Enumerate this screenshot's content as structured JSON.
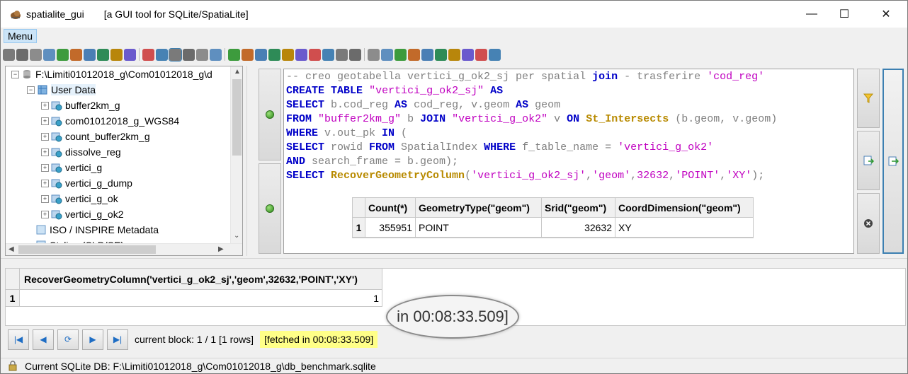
{
  "window": {
    "app_name": "spatialite_gui",
    "description": "[a GUI tool for SQLite/SpatiaLite]",
    "minimize_glyph": "—",
    "maximize_glyph": "☐",
    "close_glyph": "✕"
  },
  "menu": {
    "label": "Menu"
  },
  "toolbar": {
    "icons": [
      "connect-icon",
      "disconnect-icon",
      "create-db-icon",
      "memory-db-icon",
      "vacuum-icon",
      "attach-icon",
      "sql-script-icon",
      "load-shp-icon",
      "virtual-shp-icon",
      "load-dbf-icon",
      "load-xl-icon",
      "virtual-table-icon",
      "query-builder-icon",
      "srid-icon",
      "bug-icon",
      "eraser-icon",
      "export-icon",
      "import-icon",
      "map-icon",
      "globe-icon",
      "check-icon",
      "table-icon",
      "grid-icon",
      "report-icon",
      "calc-icon",
      "layers-icon",
      "eye-icon",
      "list-icon",
      "stats-icon",
      "wifi-icon",
      "charset-icon",
      "tools-icon",
      "text-icon",
      "help-icon",
      "about-icon",
      "exit-icon"
    ]
  },
  "tree": {
    "root": "F:\\Limiti01012018_g\\Com01012018_g\\d",
    "user_data": "User Data",
    "tables": [
      "buffer2km_g",
      "com01012018_g_WGS84",
      "count_buffer2km_g",
      "dissolve_reg",
      "vertici_g",
      "vertici_g_dump",
      "vertici_g_ok",
      "vertici_g_ok2"
    ],
    "metadata": "ISO / INSPIRE Metadata",
    "styling": "Styling (SLD/SE)"
  },
  "sql": {
    "line1_comment": "-- creo geotabella vertici_g_ok2_sj per spatial ",
    "line1_kw": "join",
    "line1_rest": " - trasferire ",
    "line1_str": "'cod_reg'",
    "create": "CREATE",
    "table": "TABLE",
    "table_name": "\"vertici_g_ok2_sj\"",
    "as": "AS",
    "select": "SELECT",
    "line3_a": " b.cod_reg ",
    "line3_b": " cod_reg, v.geom ",
    "line3_c": " geom",
    "from": "FROM",
    "buffer_tbl": "\"buffer2km_g\"",
    "line4_b": " b ",
    "join": "JOIN",
    "vertici_tbl": "\"vertici_g_ok2\"",
    "line4_v": " v ",
    "on": "ON",
    "st_intersects": "St_Intersects",
    "line4_args": " (b.geom, v.geom)",
    "where": "WHERE",
    "line5_a": " v.out_pk ",
    "in": "IN",
    "line5_b": " (",
    "line6_a": " rowid ",
    "line6_b": " SpatialIndex ",
    "line6_c": " f_table_name = ",
    "line6_str": "'vertici_g_ok2'",
    "and": "AND",
    "line7_a": " search_frame = b.geom);",
    "recover_fn": "RecoverGeometryColumn",
    "recover_args_open": "(",
    "recover_arg1": "'vertici_g_ok2_sj'",
    "recover_arg2": "'geom'",
    "recover_arg3": "32632",
    "recover_arg4": "'POINT'",
    "recover_arg5": "'XY'",
    "recover_close": ");",
    "comma": ","
  },
  "small_result": {
    "headers": [
      "Count(*)",
      "GeometryType(\"geom\")",
      "Srid(\"geom\")",
      "CoordDimension(\"geom\")"
    ],
    "row_num": "1",
    "values": [
      "355951",
      "POINT",
      "32632",
      "XY"
    ]
  },
  "result_grid": {
    "column": "RecoverGeometryColumn('vertici_g_ok2_sj','geom',32632,'POINT','XY')",
    "row_num": "1",
    "value": "1"
  },
  "callout": {
    "text": "in 00:08:33.509]"
  },
  "nav": {
    "block_text": "current block: 1 / 1 [1 rows]",
    "fetched_text": "[fetched in 00:08:33.509]"
  },
  "status": {
    "text": "Current SQLite DB: F:\\Limiti01012018_g\\Com01012018_g\\db_benchmark.sqlite"
  },
  "colors": {
    "keyword": "#0000c8",
    "string": "#c000c0",
    "function": "#b88a00",
    "highlight": "#ffff88",
    "accent": "#3c7fb1"
  }
}
